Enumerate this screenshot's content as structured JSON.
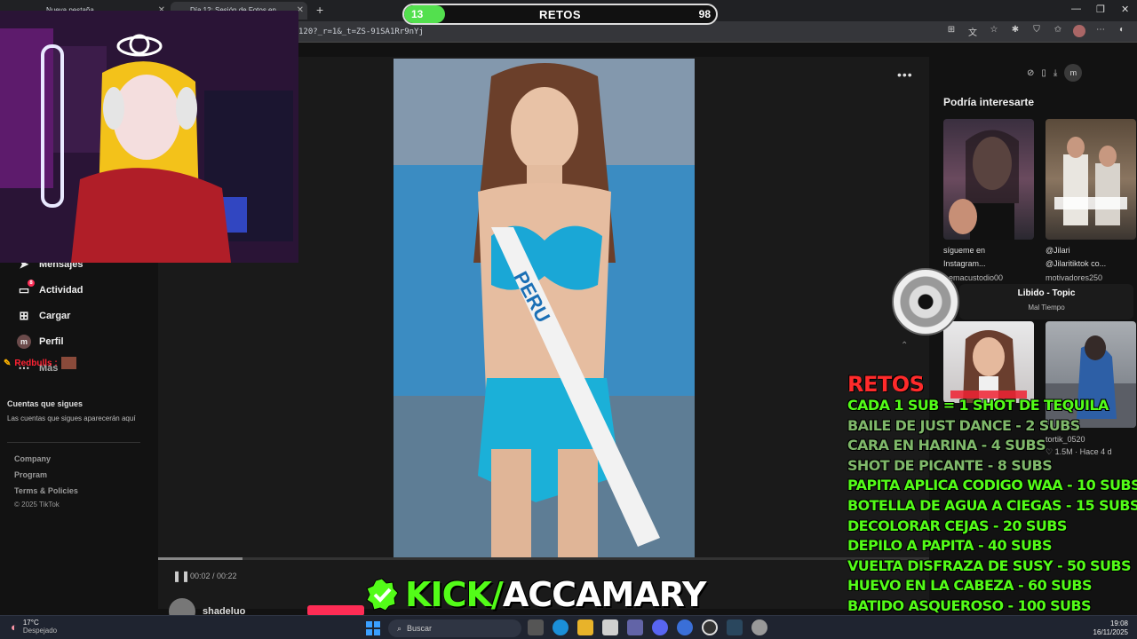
{
  "browser": {
    "tabs": [
      {
        "label": "Nueva pestaña"
      },
      {
        "label": "Día 12: Sesión de Fotos en ..."
      }
    ],
    "url": "120?_r=1&_t=ZS-91SA1Rr9nYj"
  },
  "retos_bar": {
    "current": "13",
    "title": "RETOS",
    "goal": "98",
    "progress_fraction": 0.13,
    "fill_color": "#53e04e"
  },
  "sidebar": {
    "items": [
      {
        "label": "Mensajes",
        "icon": "send-icon"
      },
      {
        "label": "Actividad",
        "icon": "activity-icon",
        "badge": "8"
      },
      {
        "label": "Cargar",
        "icon": "plus-square-icon"
      },
      {
        "label": "Perfil",
        "icon": "avatar-icon",
        "avatar_letter": "m"
      },
      {
        "label": "Más",
        "icon": "more-icon"
      }
    ],
    "overlay_user": "Redbulls :",
    "following_title": "Cuentas que sigues",
    "following_desc": "Las cuentas que sigues aparecerán aquí",
    "footer_links": [
      "Company",
      "Program",
      "Terms & Policies"
    ],
    "copyright": "© 2025 TikTok"
  },
  "player": {
    "elapsed": "00:02",
    "duration": "00:22",
    "time_text": "00:02 / 00:22",
    "progress_fraction": 0.11,
    "sash_text": "PERU",
    "author": "shadeluo"
  },
  "right_panel": {
    "title": "Podría interesarte",
    "avatar_letter": "m",
    "cards": [
      {
        "caption": "sígueme en",
        "caption2": "Instagram...",
        "user": "emacustodio00"
      },
      {
        "caption": "@Jilari",
        "caption2": "@Jilaritiktok co...",
        "user": "motivadores250"
      },
      {
        "caption": "",
        "caption2": "",
        "user": ""
      },
      {
        "caption": "",
        "caption2": "",
        "user": "tortik_0520",
        "likes": "1.5M",
        "age": "Hace 4 d"
      }
    ],
    "music_title": "Libido - Topic",
    "music_artist": "Mal Tiempo"
  },
  "retos_overlay": {
    "heading": "RETOS",
    "items": [
      {
        "text": "CADA 1 SUB = 1 SHOT DE TEQUILA",
        "done": true
      },
      {
        "text": "BAILE DE JUST DANCE - 2 SUBS",
        "done": false
      },
      {
        "text": "CARA EN HARINA - 4 SUBS",
        "done": false
      },
      {
        "text": "SHOT DE PICANTE - 8 SUBS",
        "done": false
      },
      {
        "text": "PAPITA APLICA CODIGO WAA - 10 SUBS",
        "done": true
      },
      {
        "text": "BOTELLA DE AGUA A CIEGAS - 15 SUBS",
        "done": true
      },
      {
        "text": "DECOLORAR CEJAS - 20 SUBS",
        "done": true
      },
      {
        "text": "DEPILO A PAPITA - 40 SUBS",
        "done": true
      },
      {
        "text": "VUELTA DISFRAZA DE SUSY - 50 SUBS",
        "done": true
      },
      {
        "text": "HUEVO EN LA CABEZA - 60 SUBS",
        "done": true
      },
      {
        "text": "BATIDO ASQUEROSO - 100 SUBS",
        "done": true
      }
    ],
    "done_color": "#53fc18",
    "pending_color": "#7fb86a"
  },
  "branding": {
    "kick_prefix": "KICK/",
    "channel": "ACCAMARY"
  },
  "taskbar": {
    "temperature": "17°C",
    "condition": "Despejado",
    "search_placeholder": "Buscar",
    "time": "19:08",
    "date": "16/11/2025"
  }
}
